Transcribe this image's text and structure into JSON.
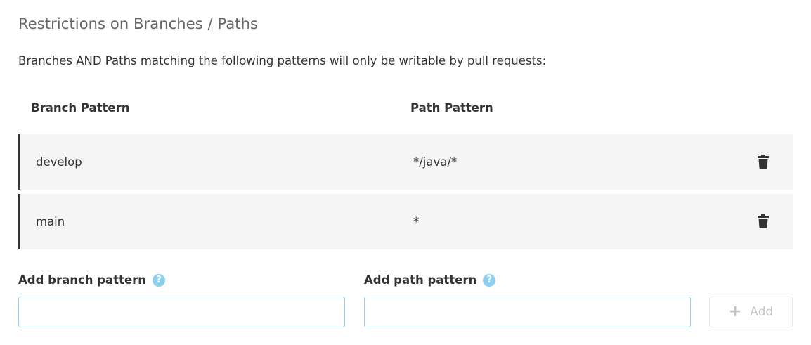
{
  "section": {
    "title": "Restrictions on Branches / Paths",
    "description": "Branches AND Paths matching the following patterns will only be writable by pull requests:"
  },
  "table": {
    "headers": {
      "branch": "Branch Pattern",
      "path": "Path Pattern"
    },
    "rows": [
      {
        "branch": "develop",
        "path": "*/java/*",
        "action_icon": "trash-icon"
      },
      {
        "branch": "main",
        "path": "*",
        "action_icon": "trash-icon"
      }
    ]
  },
  "form": {
    "branch_label": "Add branch pattern",
    "path_label": "Add path pattern",
    "help_glyph": "?",
    "branch_value": "",
    "path_value": "",
    "add_label": "Add",
    "add_icon": "plus-icon",
    "add_disabled": true
  },
  "colors": {
    "row_background": "#f5f5f5",
    "row_accent": "#333333",
    "input_border": "#93d3f0",
    "help_icon": "#8ccfee",
    "disabled_text": "#c4c4c4"
  }
}
